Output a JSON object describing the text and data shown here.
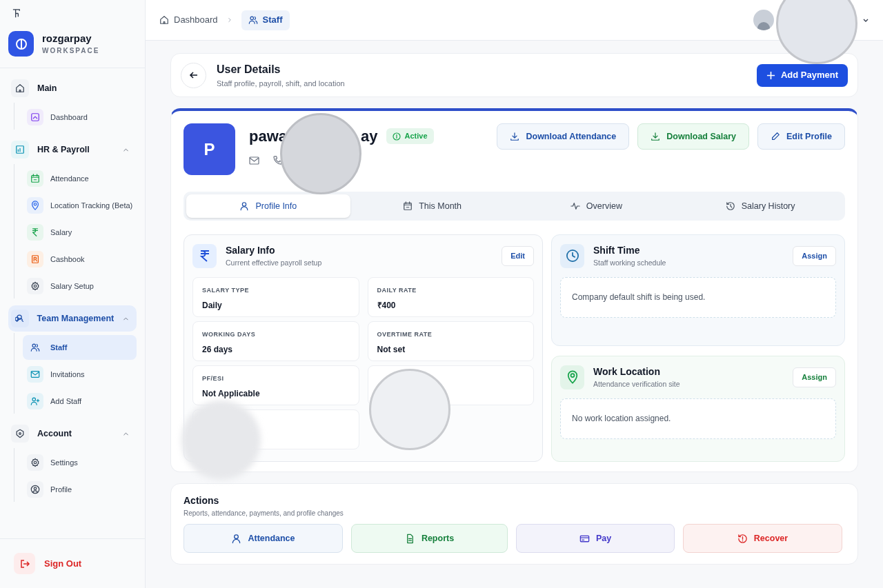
{
  "brand": {
    "name": "rozgarpay",
    "subtitle": "WORKSPACE"
  },
  "sidebar": {
    "groups": [
      {
        "label": "Main",
        "selected": false,
        "items": [
          {
            "label": "Dashboard",
            "selected": false
          }
        ]
      },
      {
        "label": "HR & Payroll",
        "selected": false,
        "expanded": true,
        "items": [
          {
            "label": "Attendance",
            "selected": false
          },
          {
            "label": "Location Tracking (Beta)",
            "selected": false
          },
          {
            "label": "Salary",
            "selected": false
          },
          {
            "label": "Cashbook",
            "selected": false
          },
          {
            "label": "Salary Setup",
            "selected": false
          }
        ]
      },
      {
        "label": "Team Management",
        "selected": true,
        "expanded": true,
        "items": [
          {
            "label": "Staff",
            "selected": true
          },
          {
            "label": "Invitations",
            "selected": false
          },
          {
            "label": "Add Staff",
            "selected": false
          }
        ]
      },
      {
        "label": "Account",
        "selected": false,
        "expanded": true,
        "items": [
          {
            "label": "Settings",
            "selected": false
          },
          {
            "label": "Profile",
            "selected": false
          }
        ]
      }
    ],
    "sign_out": "Sign Out"
  },
  "breadcrumb": [
    {
      "label": "Dashboard",
      "selected": false
    },
    {
      "label": "Staff",
      "selected": true
    }
  ],
  "page_header": {
    "title": "User Details",
    "subtitle": "Staff profile, payroll, shift, and location",
    "button": "Add Payment"
  },
  "profile": {
    "initial": "P",
    "name_start": "pawa",
    "name_end": "ay",
    "status": "Active",
    "buttons": [
      {
        "label": "Download Attendance",
        "kind": "blue"
      },
      {
        "label": "Download Salary",
        "kind": "green"
      },
      {
        "label": "Edit Profile",
        "kind": "blue"
      }
    ]
  },
  "tabs": [
    {
      "label": "Profile Info",
      "selected": true
    },
    {
      "label": "This Month",
      "selected": false
    },
    {
      "label": "Overview",
      "selected": false
    },
    {
      "label": "Salary History",
      "selected": false
    }
  ],
  "salary_info": {
    "title": "Salary Info",
    "subtitle": "Current effective payroll setup",
    "button": "Edit",
    "fields": [
      {
        "kind": "value",
        "label": "SALARY TYPE",
        "value": "Daily"
      },
      {
        "kind": "value",
        "label": "DAILY RATE",
        "value": "₹400"
      },
      {
        "kind": "value",
        "label": "WORKING DAYS",
        "value": "26 days"
      },
      {
        "kind": "value",
        "label": "OVERTIME RATE",
        "value": "Not set"
      },
      {
        "kind": "value",
        "label": "PF/ESI",
        "value": "Not Applicable"
      },
      {
        "kind": "blank"
      },
      {
        "kind": "blank"
      }
    ]
  },
  "shift_time": {
    "title": "Shift Time",
    "subtitle": "Staff working schedule",
    "button": "Assign",
    "message": "Company default shift is being used."
  },
  "work_location": {
    "title": "Work Location",
    "subtitle": "Attendance verification site",
    "button": "Assign",
    "message": "No work location assigned."
  },
  "actions": {
    "title": "Actions",
    "subtitle": "Reports, attendance, payments, and profile changes",
    "buttons": [
      {
        "label": "Attendance",
        "kind": "blue"
      },
      {
        "label": "Reports",
        "kind": "green"
      },
      {
        "label": "Pay",
        "kind": "purple"
      },
      {
        "label": "Recover",
        "kind": "red"
      }
    ]
  }
}
